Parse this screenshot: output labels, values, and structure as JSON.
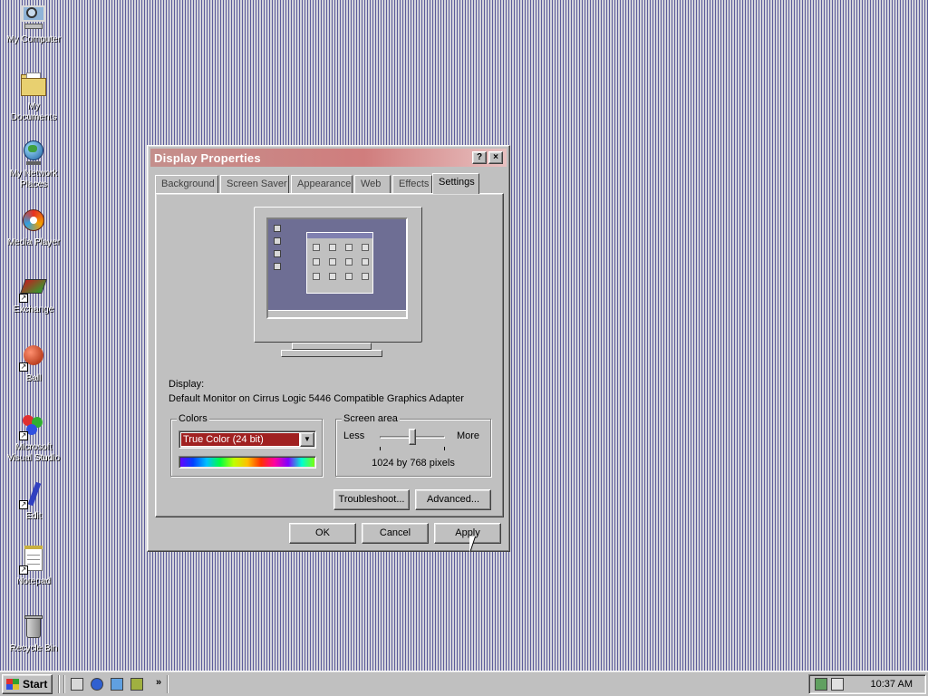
{
  "desktop": {
    "icons": [
      {
        "label": "My Computer"
      },
      {
        "label": "My Documents"
      },
      {
        "label": "My Network Places"
      },
      {
        "label": "Media Player"
      },
      {
        "label": "Exchange"
      },
      {
        "label": "Ball"
      },
      {
        "label": "Microsoft Visual Studio"
      },
      {
        "label": "Edit"
      },
      {
        "label": "Notepad"
      },
      {
        "label": "Recycle Bin"
      }
    ]
  },
  "dialog": {
    "title": "Display Properties",
    "help_button": "?",
    "close_button": "×",
    "tabs": [
      "Background",
      "Screen Saver",
      "Appearance",
      "Web",
      "Effects",
      "Settings"
    ],
    "active_tab": "Settings",
    "display_label": "Display:",
    "display_value": "Default Monitor on Cirrus Logic 5446 Compatible Graphics Adapter",
    "colors": {
      "label": "Colors",
      "selected": "True Color (24 bit)"
    },
    "screen_area": {
      "label": "Screen area",
      "less": "Less",
      "more": "More",
      "resolution": "1024 by 768 pixels",
      "slider_position_fraction": 0.5
    },
    "buttons": {
      "troubleshoot": "Troubleshoot...",
      "advanced": "Advanced...",
      "ok": "OK",
      "cancel": "Cancel",
      "apply": "Apply"
    },
    "title_color": "#d07d7d"
  },
  "taskbar": {
    "start_label": "Start",
    "quick_launch": [
      "show-desktop-icon",
      "internet-explorer-icon",
      "outlook-express-icon",
      "media-icon"
    ],
    "chevron": "»",
    "clock": "10:37 AM"
  }
}
